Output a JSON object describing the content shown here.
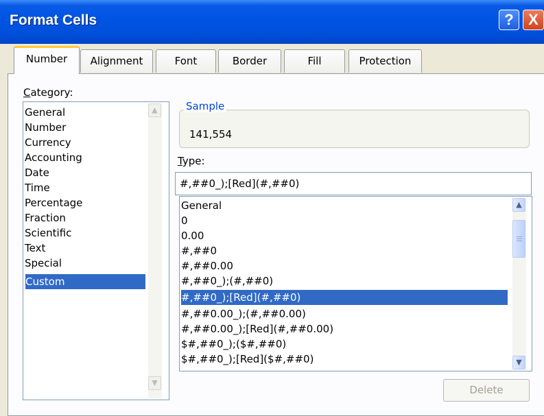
{
  "window": {
    "title": "Format Cells"
  },
  "tabs": [
    "Number",
    "Alignment",
    "Font",
    "Border",
    "Fill",
    "Protection"
  ],
  "category": {
    "label_prefix": "C",
    "label_rest": "ategory:",
    "items": [
      "General",
      "Number",
      "Currency",
      "Accounting",
      "Date",
      "Time",
      "Percentage",
      "Fraction",
      "Scientific",
      "Text",
      "Special",
      "Custom"
    ],
    "selected": "Custom"
  },
  "sample": {
    "legend": "Sample",
    "value": "141,554"
  },
  "type": {
    "label_prefix": "T",
    "label_rest": "ype:",
    "value": "#,##0_);[Red](#,##0)",
    "options": [
      "General",
      "0",
      "0.00",
      "#,##0",
      "#,##0.00",
      "#,##0_);(#,##0)",
      "#,##0_);[Red](#,##0)",
      "#,##0.00_);(#,##0.00)",
      "#,##0.00_);[Red](#,##0.00)",
      "$#,##0_);($#,##0)",
      "$#,##0_);[Red]($#,##0)"
    ],
    "selected": "#,##0_);[Red](#,##0)"
  },
  "buttons": {
    "delete": "Delete"
  },
  "icons": {
    "help": "?",
    "close": "X",
    "scroll_up": "▲",
    "scroll_down": "▼"
  },
  "colors": {
    "titlebar": "#0054e3",
    "selection": "#316ac5",
    "tab_highlight": "#ffc83c",
    "legend": "#0046d5",
    "dialog_bg": "#ece9d8"
  }
}
